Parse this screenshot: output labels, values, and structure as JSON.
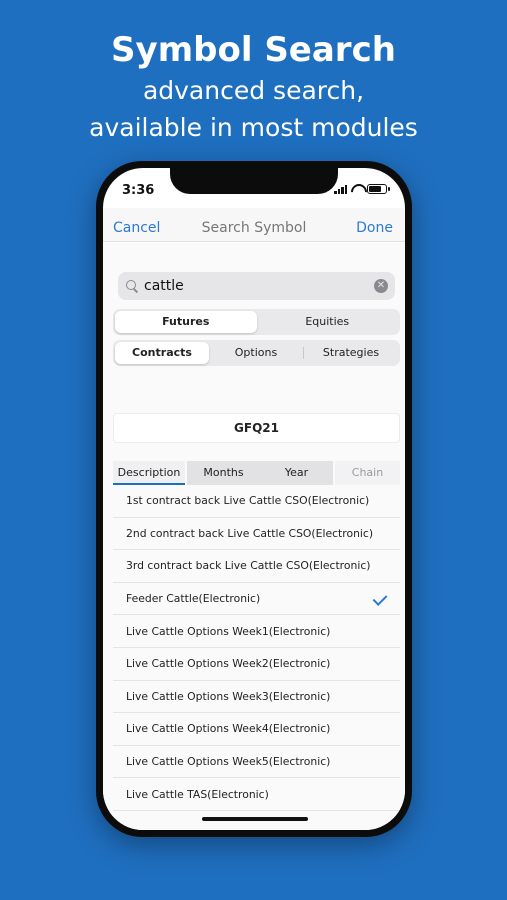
{
  "headline": {
    "title": "Symbol Search",
    "line1": "advanced search,",
    "line2": "available in most modules"
  },
  "status": {
    "time": "3:36"
  },
  "navbar": {
    "cancel": "Cancel",
    "title": "Search Symbol",
    "done": "Done"
  },
  "search": {
    "value": "cattle",
    "clear_icon": "clear-icon"
  },
  "market_segment": {
    "options": [
      "Futures",
      "Equities"
    ],
    "selected": "Futures"
  },
  "type_segment": {
    "options": [
      "Contracts",
      "Options",
      "Strategies"
    ],
    "selected": "Contracts"
  },
  "symbol": "GFQ21",
  "tabs": {
    "description": "Description",
    "months": "Months",
    "year": "Year",
    "chain": "Chain"
  },
  "results": [
    {
      "label": "1st contract back Live Cattle CSO(Electronic)",
      "checked": false
    },
    {
      "label": "2nd contract back Live Cattle CSO(Electronic)",
      "checked": false
    },
    {
      "label": "3rd contract back Live Cattle CSO(Electronic)",
      "checked": false
    },
    {
      "label": "Feeder Cattle(Electronic)",
      "checked": true
    },
    {
      "label": "Live Cattle Options Week1(Electronic)",
      "checked": false
    },
    {
      "label": "Live Cattle Options Week2(Electronic)",
      "checked": false
    },
    {
      "label": "Live Cattle Options Week3(Electronic)",
      "checked": false
    },
    {
      "label": "Live Cattle Options Week4(Electronic)",
      "checked": false
    },
    {
      "label": "Live Cattle Options Week5(Electronic)",
      "checked": false
    },
    {
      "label": "Live Cattle TAS(Electronic)",
      "checked": false
    }
  ],
  "colors": {
    "background": "#1f6fc0",
    "accent": "#2a7ad5"
  }
}
